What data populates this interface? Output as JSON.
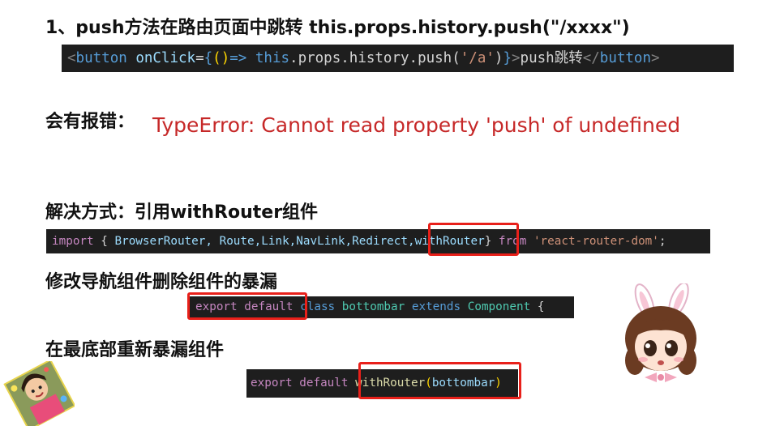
{
  "section1": {
    "title": "1、push方法在路由页面中跳转 this.props.history.push(\"/xxxx\")",
    "code": {
      "tag_open": "<",
      "tag_name": "button",
      "attr": "onClick",
      "eq": "=",
      "brace_open": "{",
      "parens": "()",
      "arrow": "=>",
      "this_kw": "this",
      "chain": ".props.history.push(",
      "path": "'/a'",
      "close": ")",
      "brace_close": "}",
      "gt": ">",
      "inner_text": "push跳转",
      "tag_close": "</",
      "tag_close_name": "button",
      "tag_end": ">"
    }
  },
  "section2": {
    "label": "会有报错：",
    "error": "TypeError: Cannot read property 'push' of undefined"
  },
  "section3": {
    "title": "解决方式：引用withRouter组件",
    "code": {
      "import_kw": "import",
      "open": " { ",
      "names": "BrowserRouter, Route,Link,NavLink,Redirect,",
      "with_router": "withRouter",
      "close": "} ",
      "from_kw": "from",
      "module": "'react-router-dom'",
      "semi": ";"
    }
  },
  "section4": {
    "title": "修改导航组件删除组件的暴漏",
    "code": {
      "export_default": "export default",
      "class_kw": "class",
      "class_name": "bottombar",
      "extends_kw": "extends",
      "base": "Component",
      "brace": "{"
    }
  },
  "section5": {
    "title": "在最底部重新暴漏组件",
    "code": {
      "export_default": "export default",
      "with_router": "withRouter",
      "paren_open": "(",
      "arg": "bottombar",
      "paren_close": ")"
    }
  },
  "colors": {
    "highlight": "#e8201a",
    "error_text": "#c62828",
    "code_bg": "#1e1e1e"
  }
}
